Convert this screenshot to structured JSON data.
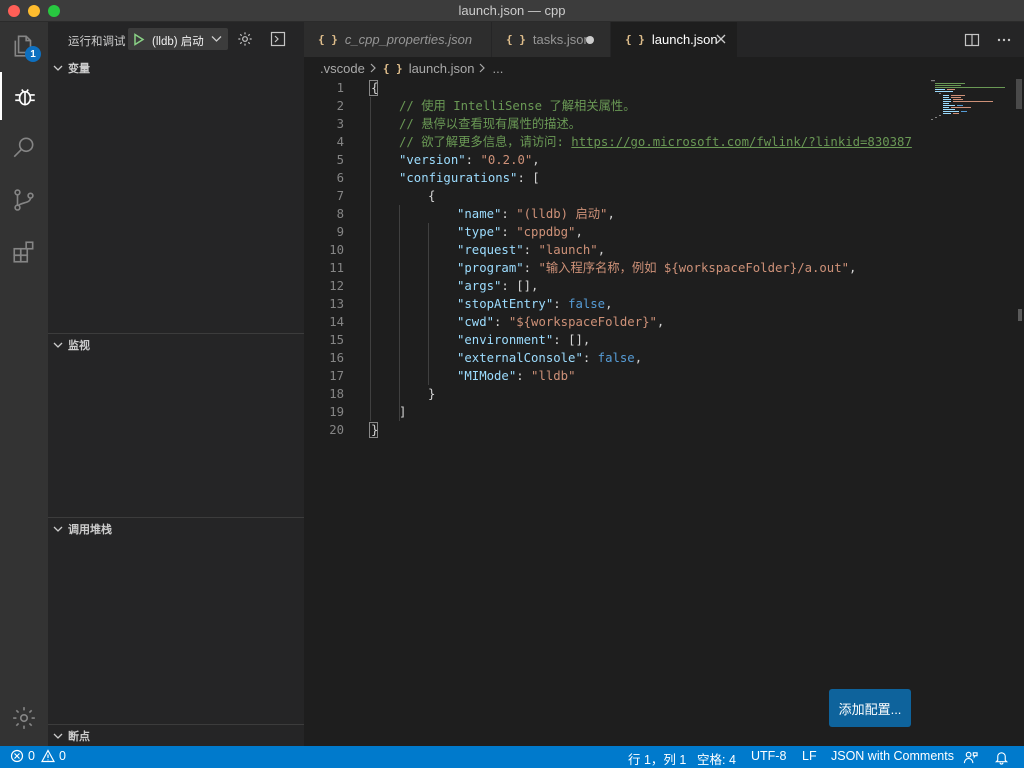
{
  "window": {
    "title": "launch.json — cpp"
  },
  "activity": {
    "explorer_badge": "1"
  },
  "sidebar": {
    "title": "运行和调试",
    "config_name": "(lldb) 启动",
    "sections": {
      "variables": "变量",
      "watch": "监视",
      "callstack": "调用堆栈",
      "breakpoints": "断点"
    }
  },
  "tabs": [
    {
      "label": "c_cpp_properties.json",
      "icon": "{ }"
    },
    {
      "label": "tasks.json",
      "icon": "{ }"
    },
    {
      "label": "launch.json",
      "icon": "{ }"
    }
  ],
  "breadcrumb": {
    "folder": ".vscode",
    "file": "launch.json",
    "more": "..."
  },
  "editor": {
    "lines": [
      "1",
      "2",
      "3",
      "4",
      "5",
      "6",
      "7",
      "8",
      "9",
      "10",
      "11",
      "12",
      "13",
      "14",
      "15",
      "16",
      "17",
      "18",
      "19",
      "20"
    ],
    "code": {
      "l1": "{",
      "l2": "// 使用 IntelliSense 了解相关属性。",
      "l3": "// 悬停以查看现有属性的描述。",
      "l4_prefix": "// 欲了解更多信息，请访问: ",
      "l4_link": "https://go.microsoft.com/fwlink/?linkid=830387",
      "version_key": "\"version\"",
      "version_val": "\"0.2.0\"",
      "configurations_key": "\"configurations\"",
      "open_bracket": "[",
      "open_obj": "{",
      "name_key": "\"name\"",
      "name_val": "\"(lldb) 启动\"",
      "type_key": "\"type\"",
      "type_val": "\"cppdbg\"",
      "request_key": "\"request\"",
      "request_val": "\"launch\"",
      "program_key": "\"program\"",
      "program_val": "\"输入程序名称，例如 ${workspaceFolder}/a.out\"",
      "args_key": "\"args\"",
      "args_val": "[]",
      "stop_key": "\"stopAtEntry\"",
      "stop_val": "false",
      "cwd_key": "\"cwd\"",
      "cwd_val": "\"${workspaceFolder}\"",
      "env_key": "\"environment\"",
      "env_val": "[]",
      "ext_key": "\"externalConsole\"",
      "ext_val": "false",
      "mimode_key": "\"MIMode\"",
      "mimode_val": "\"lldb\"",
      "close_obj": "}",
      "close_bracket": "]",
      "close_root": "}"
    },
    "add_config_button": "添加配置..."
  },
  "status": {
    "errors": "0",
    "warnings": "0",
    "position": "行 1，列 1",
    "spaces": "空格: 4",
    "encoding": "UTF-8",
    "eol": "LF",
    "language": "JSON with Comments"
  },
  "colors": {
    "accent": "#007acc",
    "button": "#0e639c",
    "badge": "#0e70c0"
  }
}
